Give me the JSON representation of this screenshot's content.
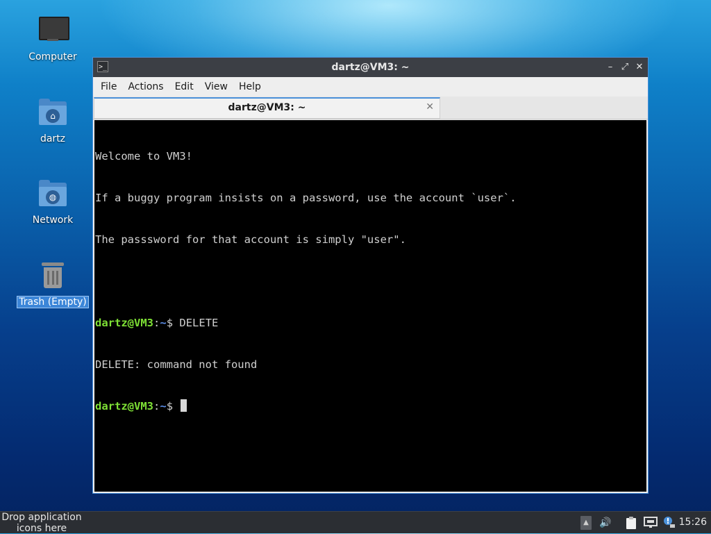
{
  "desktop": {
    "icons": [
      {
        "label": "Computer",
        "icon": "computer-icon"
      },
      {
        "label": "dartz",
        "icon": "home-folder-icon"
      },
      {
        "label": "Network",
        "icon": "network-folder-icon"
      },
      {
        "label": "Trash (Empty)",
        "icon": "trash-icon"
      }
    ]
  },
  "window": {
    "title": "dartz@VM3: ~",
    "app_icon_glyph": ">_",
    "controls": {
      "minimize": "–",
      "maximize": "⤢",
      "close": "✕"
    },
    "menu": [
      "File",
      "Actions",
      "Edit",
      "View",
      "Help"
    ],
    "tab": {
      "title": "dartz@VM3: ~",
      "close": "✕"
    }
  },
  "terminal": {
    "lines": [
      "Welcome to VM3!",
      "If a buggy program insists on a password, use the account `user`.",
      "The passsword for that account is simply \"user\"."
    ],
    "prompt_user": "dartz@VM3",
    "prompt_sep": ":",
    "prompt_path": "~",
    "prompt_symbol": "$",
    "command1": " DELETE",
    "output1": "DELETE: command not found"
  },
  "panel": {
    "launcher_hint": "Drop application icons here",
    "clock": "15:26",
    "tray": [
      "arrow-up-icon",
      "volume-icon",
      "clipboard-icon",
      "network-icon",
      "notification-icon"
    ]
  },
  "colors": {
    "accent": "#4a90d9",
    "prompt_user": "#7ee035",
    "prompt_path": "#5c8ee8"
  }
}
